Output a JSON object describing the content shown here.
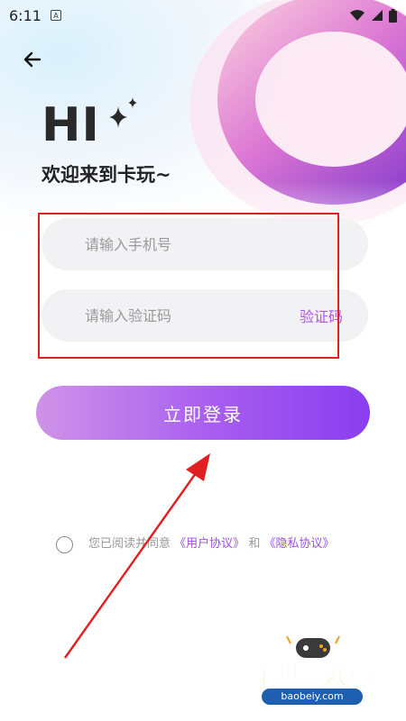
{
  "status_bar": {
    "time": "6:11",
    "notification_glyph": "A",
    "icons": [
      "wifi-icon",
      "signal-icon",
      "battery-icon"
    ]
  },
  "header": {
    "greeting": "HI",
    "welcome": "欢迎来到卡玩~"
  },
  "form": {
    "phone_placeholder": "请输入手机号",
    "code_placeholder": "请输入验证码",
    "get_code_label": "验证码"
  },
  "login_button": {
    "label": "立即登录"
  },
  "agreement": {
    "prefix": "您已阅读并同意",
    "user_agreement": "《用户协议》",
    "joiner": "和",
    "privacy_policy": "《隐私协议》"
  },
  "watermark": {
    "title": "宝贝游戏网",
    "url": "baobeiy.com"
  },
  "colors": {
    "accent": "#9b4fe0",
    "button_start": "#cf93e8",
    "button_end": "#8a3df0",
    "highlight_frame": "#e02020",
    "field_bg": "#f2f2f4"
  }
}
